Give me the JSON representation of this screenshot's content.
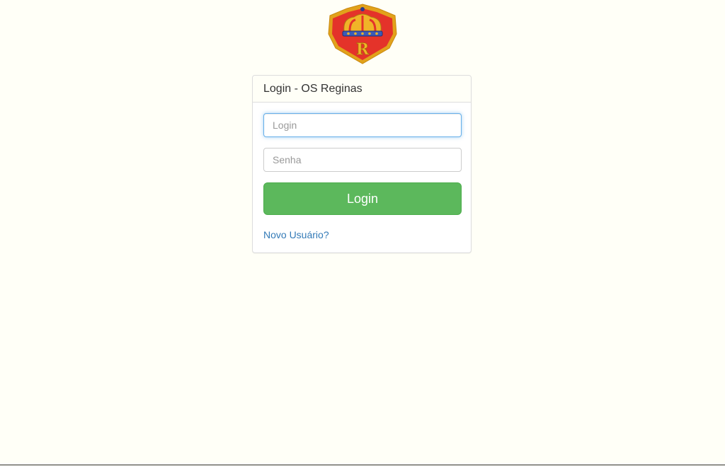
{
  "logo": {
    "icon": "crown-r-shield-icon",
    "letter": "R"
  },
  "login_panel": {
    "title": "Login - OS Reginas",
    "login_field": {
      "placeholder": "Login",
      "value": ""
    },
    "password_field": {
      "placeholder": "Senha",
      "value": ""
    },
    "submit_label": "Login",
    "new_user_link": "Novo Usuário?"
  },
  "colors": {
    "background": "#fffff7",
    "button": "#5cb85c",
    "link": "#337ab7",
    "focus_border": "#66afe9"
  }
}
